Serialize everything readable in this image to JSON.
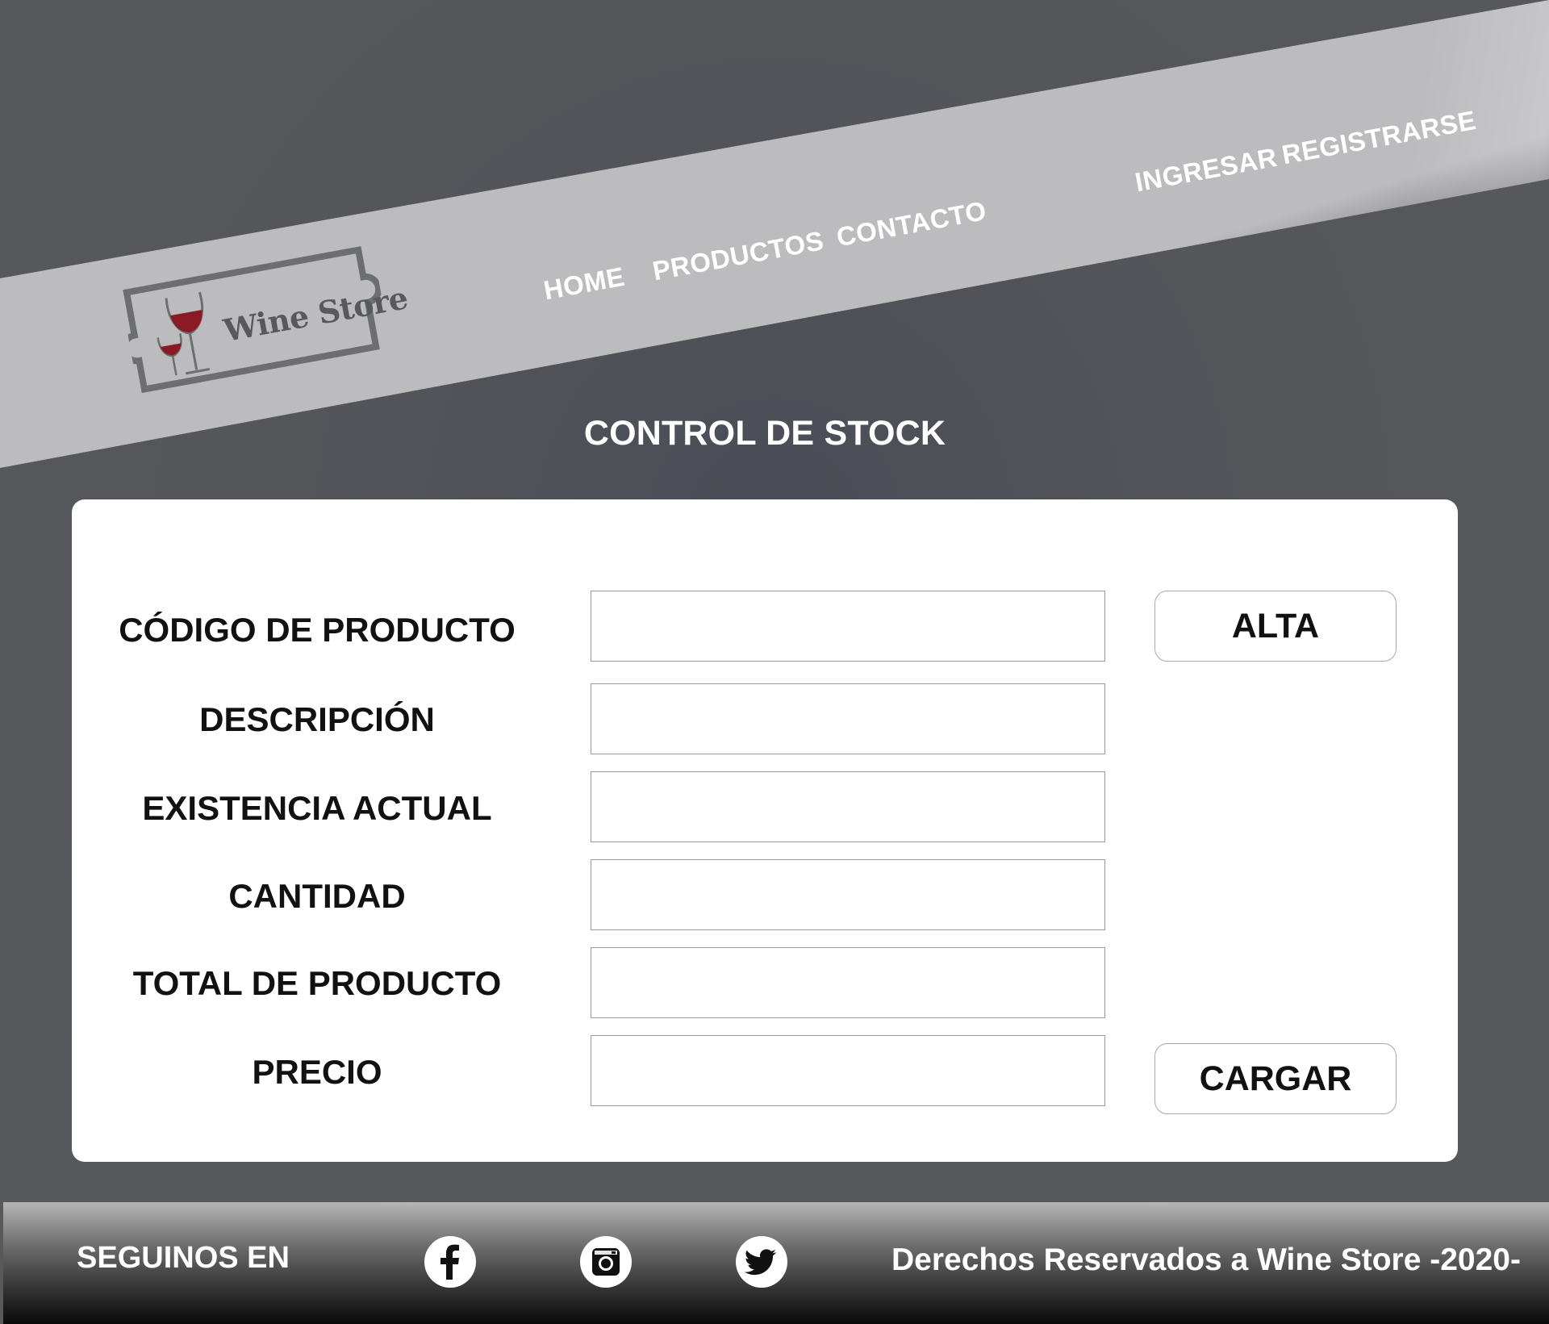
{
  "header": {
    "brand": "Wine Store",
    "nav": [
      {
        "label": "HOME"
      },
      {
        "label": "PRODUCTOS"
      },
      {
        "label": "CONTACTO"
      }
    ],
    "auth": {
      "login": "INGRESAR",
      "register": "REGISTRARSE"
    }
  },
  "main": {
    "title": "CONTROL DE STOCK",
    "fields": [
      {
        "label": "CÓDIGO DE PRODUCTO",
        "value": ""
      },
      {
        "label": "DESCRIPCIÓN",
        "value": ""
      },
      {
        "label": "EXISTENCIA ACTUAL",
        "value": ""
      },
      {
        "label": "CANTIDAD",
        "value": ""
      },
      {
        "label": "TOTAL DE PRODUCTO",
        "value": ""
      },
      {
        "label": "PRECIO",
        "value": ""
      }
    ],
    "buttons": {
      "alta": "ALTA",
      "cargar": "CARGAR"
    }
  },
  "footer": {
    "follow": "SEGUINOS EN",
    "social_icons": [
      "facebook-icon",
      "instagram-icon",
      "twitter-icon"
    ],
    "copyright": "Derechos Reservados a Wine Store -2020-"
  },
  "colors": {
    "background": "#54565a",
    "band": "#bdbdbf",
    "wine": "#8b1a24",
    "logo_gray": "#6d6e70"
  }
}
